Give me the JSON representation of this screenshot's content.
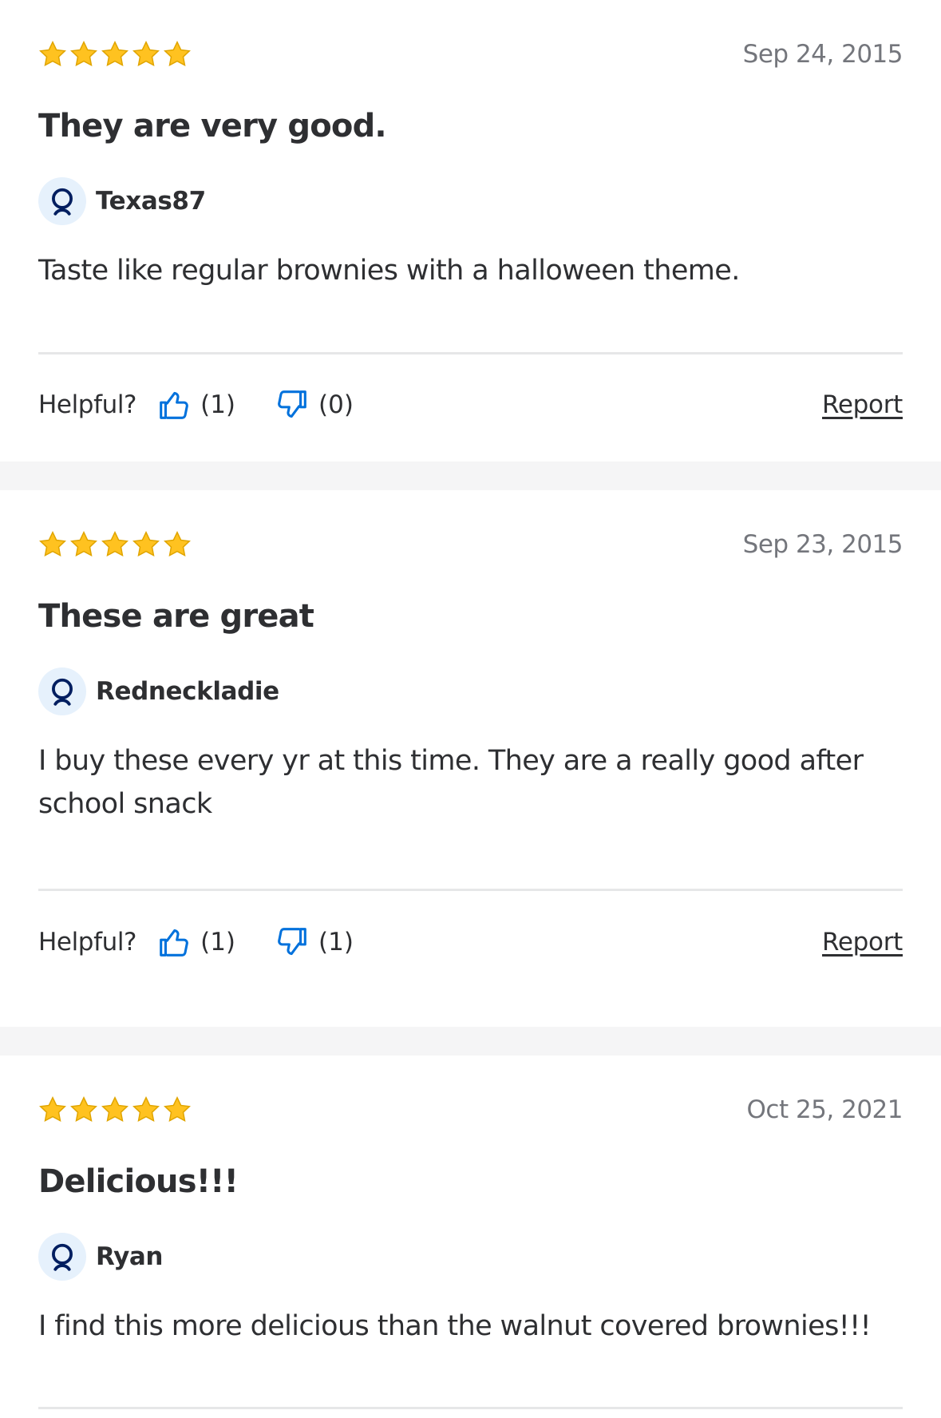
{
  "colors": {
    "star": "#ffc220",
    "star_outline": "#e0a500",
    "thumb": "#0071dc",
    "avatar_bg": "#e6f1fc",
    "avatar_icon": "#001e60",
    "separator": "#f5f5f6"
  },
  "icons": {
    "star": "star-icon",
    "avatar": "user-icon",
    "thumbs_up": "thumbs-up-icon",
    "thumbs_down": "thumbs-down-icon"
  },
  "reviews": [
    {
      "rating": 5,
      "date": "Sep 24, 2015",
      "title": "They are very good.",
      "author": "Texas87",
      "body": "Taste like regular brownies with a halloween theme.",
      "helpful_label": "Helpful?",
      "up_count": "(1)",
      "down_count": "(0)",
      "report_label": "Report"
    },
    {
      "rating": 5,
      "date": "Sep 23, 2015",
      "title": "These are great",
      "author": "Redneckladie",
      "body": "I buy these every yr at this time. They are a really good after school snack",
      "helpful_label": "Helpful?",
      "up_count": "(1)",
      "down_count": "(1)",
      "report_label": "Report"
    },
    {
      "rating": 5,
      "date": "Oct 25, 2021",
      "title": "Delicious!!!",
      "author": "Ryan",
      "body": "I find this more delicious than the walnut covered brownies!!!"
    }
  ]
}
